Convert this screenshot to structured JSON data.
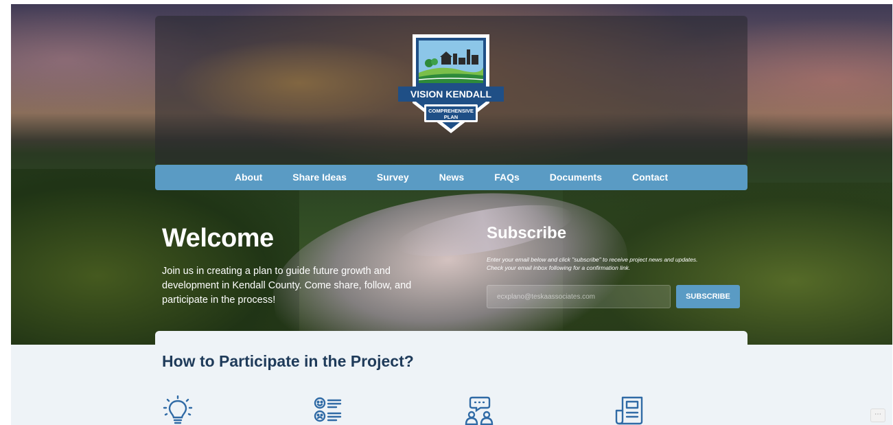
{
  "logo": {
    "name": "VISION KENDALL",
    "tagline_line1": "COMPREHENSIVE",
    "tagline_line2": "PLAN"
  },
  "nav": {
    "items": [
      {
        "label": "About"
      },
      {
        "label": "Share Ideas"
      },
      {
        "label": "Survey"
      },
      {
        "label": "News"
      },
      {
        "label": "FAQs"
      },
      {
        "label": "Documents"
      },
      {
        "label": "Contact"
      }
    ]
  },
  "welcome": {
    "title": "Welcome",
    "text": "Join us in creating a plan to guide future growth and development in Kendall County. Come share, follow, and participate in the process!"
  },
  "subscribe": {
    "title": "Subscribe",
    "text_line1": "Enter your email below and click \"subscribe\" to receive project news and updates.",
    "text_line2": "Check your email inbox following for a confirmation link.",
    "placeholder": "ecxplano@teskaassociates.com",
    "button_label": "SUBSCRIBE"
  },
  "participate": {
    "title": "How to Participate in the Project?",
    "icons": [
      "lightbulb-icon",
      "survey-faces-icon",
      "discussion-people-icon",
      "newsletter-icon"
    ]
  },
  "more_button": "⋯",
  "colors": {
    "nav_blue": "#5a9bc4",
    "heading_navy": "#1f3b5a",
    "icon_blue": "#2f6aa5",
    "light_bg": "#eef3f7"
  }
}
